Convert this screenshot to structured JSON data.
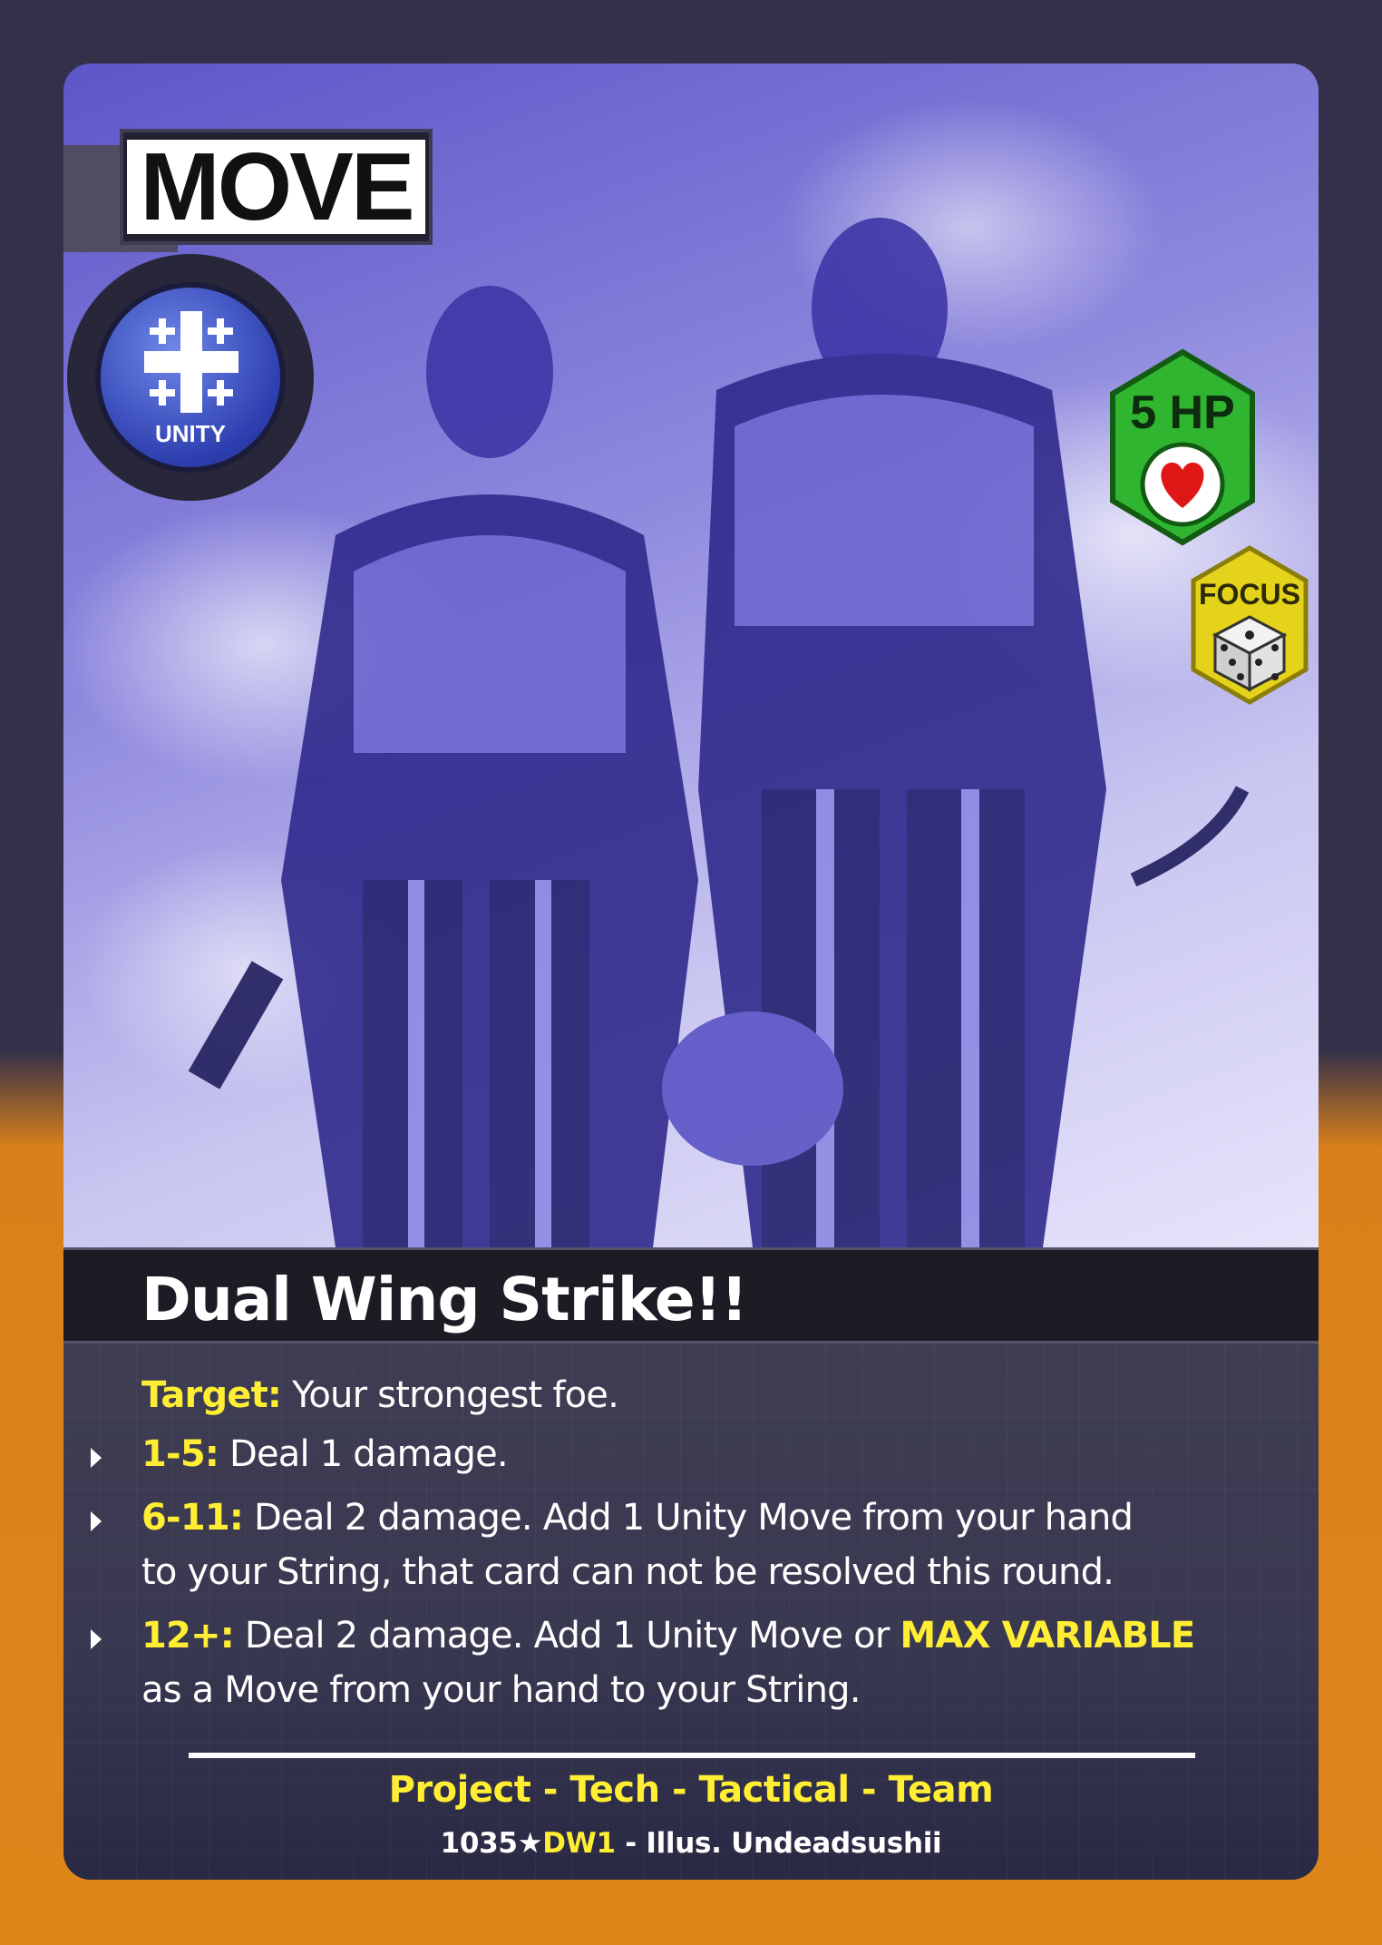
{
  "card": {
    "type": "MOVE",
    "affinity": "UNITY",
    "hp": "5 HP",
    "stat": "FOCUS",
    "name": "Dual Wing Strike!!",
    "target_label": "Target:",
    "target_text": "Your strongest foe.",
    "effects": [
      {
        "roll": "1-5:",
        "lines": [
          "Deal 1 damage."
        ]
      },
      {
        "roll": "6-11:",
        "lines": [
          "Deal 2 damage. Add 1 Unity Move from your hand",
          "to your String, that card can not be resolved this round."
        ]
      },
      {
        "roll": "12+:",
        "lines_pre": "Deal 2 damage. Add 1 Unity Move or ",
        "highlight": "MAX VARIABLE",
        "line2": "as a Move from your hand to your String."
      }
    ],
    "traits": "Project - Tech - Tactical - Team",
    "number": "1035",
    "star": "★",
    "set_code": "DW1",
    "illustrator": " - Illus. Undeadsushii"
  },
  "colors": {
    "keyword": "#ffee33",
    "hp_green": "#2fb52f",
    "focus_yellow": "#e5d21b",
    "unity_blue": "#3b4fc8"
  },
  "icons": [
    "unity-cross-icon",
    "heart-icon",
    "die-icon",
    "bullet-arrow-icon"
  ]
}
